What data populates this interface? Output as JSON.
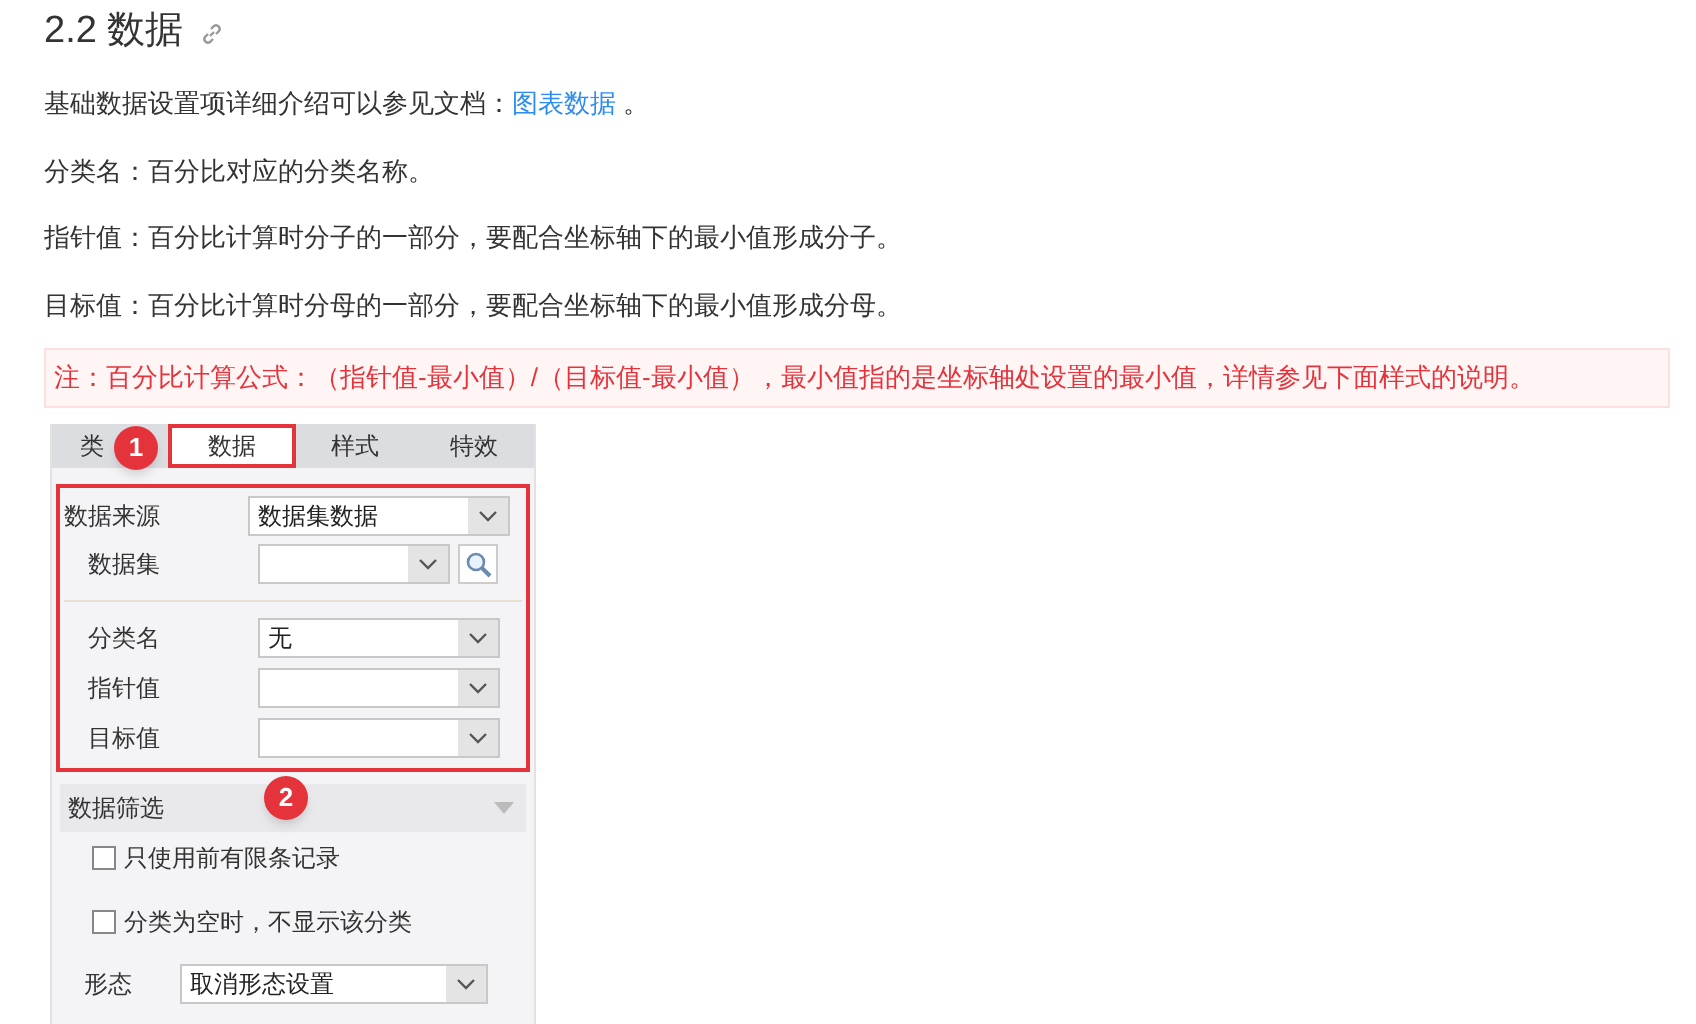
{
  "heading": "2.2 数据",
  "intro": {
    "text": "基础数据设置项详细介绍可以参见文档：",
    "link": "图表数据",
    "tail": " 。"
  },
  "paragraphs": [
    "分类名：百分比对应的分类名称。",
    "指针值：百分比计算时分子的一部分，要配合坐标轴下的最小值形成分子。",
    "目标值：百分比计算时分母的一部分，要配合坐标轴下的最小值形成分母。"
  ],
  "note": "注：百分比计算公式：（指针值-最小值）/（目标值-最小值），最小值指的是坐标轴处设置的最小值，详情参见下面样式的说明。",
  "panel": {
    "tabs": [
      {
        "label": "类",
        "selected": false
      },
      {
        "label": "数据",
        "selected": true
      },
      {
        "label": "样式",
        "selected": false
      },
      {
        "label": "特效",
        "selected": false
      }
    ],
    "badges": [
      "1",
      "2"
    ],
    "source": {
      "label": "数据来源",
      "value": "数据集数据"
    },
    "dataset": {
      "label": "数据集"
    },
    "fields": [
      {
        "label": "分类名",
        "value": "无"
      },
      {
        "label": "指针值"
      },
      {
        "label": "目标值"
      }
    ],
    "filter": {
      "title": "数据筛选",
      "options": [
        {
          "label": "只使用前有限条记录",
          "checked": false
        },
        {
          "label": "分类为空时，不显示该分类",
          "checked": false
        }
      ]
    },
    "form": {
      "label": "形态",
      "value": "取消形态设置"
    }
  }
}
